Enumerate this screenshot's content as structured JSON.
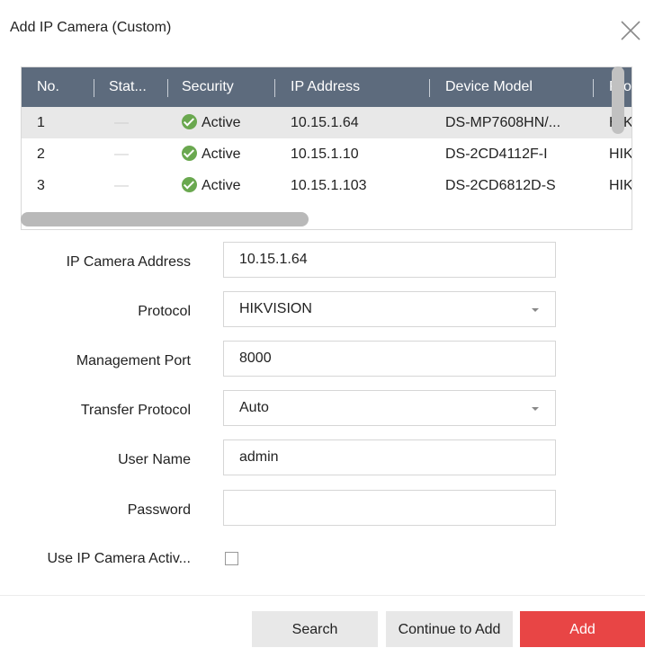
{
  "dialog": {
    "title": "Add IP Camera (Custom)"
  },
  "table": {
    "columns": [
      "No.",
      "Stat...",
      "Security",
      "IP Address",
      "Device Model",
      "Pro"
    ],
    "rows": [
      {
        "no": "1",
        "status": "—",
        "security": "Active",
        "ip": "10.15.1.64",
        "model": "DS-MP7608HN/...",
        "protocol": "HIK"
      },
      {
        "no": "2",
        "status": "—",
        "security": "Active",
        "ip": "10.15.1.10",
        "model": "DS-2CD4112F-I",
        "protocol": "HIK"
      },
      {
        "no": "3",
        "status": "—",
        "security": "Active",
        "ip": "10.15.1.103",
        "model": "DS-2CD6812D-S",
        "protocol": "HIK"
      }
    ],
    "selected_row": 0
  },
  "form": {
    "ip_address_label": "IP Camera Address",
    "ip_address_value": "10.15.1.64",
    "protocol_label": "Protocol",
    "protocol_value": "HIKVISION",
    "management_port_label": "Management Port",
    "management_port_value": "8000",
    "transfer_protocol_label": "Transfer Protocol",
    "transfer_protocol_value": "Auto",
    "user_name_label": "User Name",
    "user_name_value": "admin",
    "password_label": "Password",
    "password_value": "",
    "activation_label": "Use IP Camera Activ...",
    "activation_checked": false
  },
  "buttons": {
    "search": "Search",
    "continue": "Continue to Add",
    "add": "Add"
  },
  "colors": {
    "header_bg": "#5d6b7d",
    "selected_row_bg": "#e8e8e8",
    "active_green": "#6aa84f",
    "add_button": "#e84545"
  }
}
